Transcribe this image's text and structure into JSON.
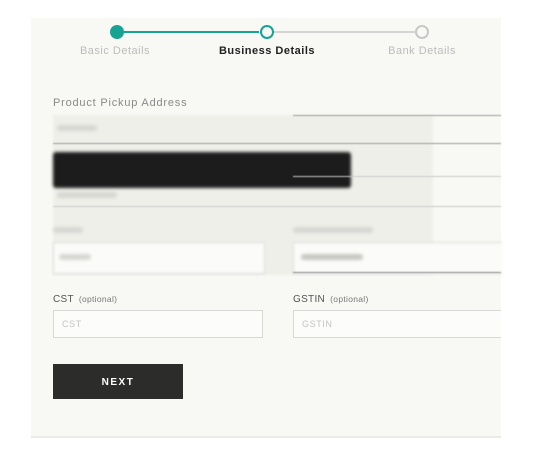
{
  "stepper": {
    "steps": [
      {
        "label": "Basic Details",
        "state": "completed"
      },
      {
        "label": "Business Details",
        "state": "active"
      },
      {
        "label": "Bank Details",
        "state": "pending"
      }
    ],
    "accent_color": "#17a394"
  },
  "form": {
    "section_title": "Product Pickup Address",
    "cst": {
      "label": "CST",
      "optional": "(optional)",
      "placeholder": "CST"
    },
    "gstin": {
      "label": "GSTIN",
      "optional": "(optional)",
      "placeholder": "GSTIN"
    },
    "next_label": "NEXT"
  },
  "icons": [
    "step-completed-dot",
    "step-active-dot",
    "step-pending-dot"
  ]
}
